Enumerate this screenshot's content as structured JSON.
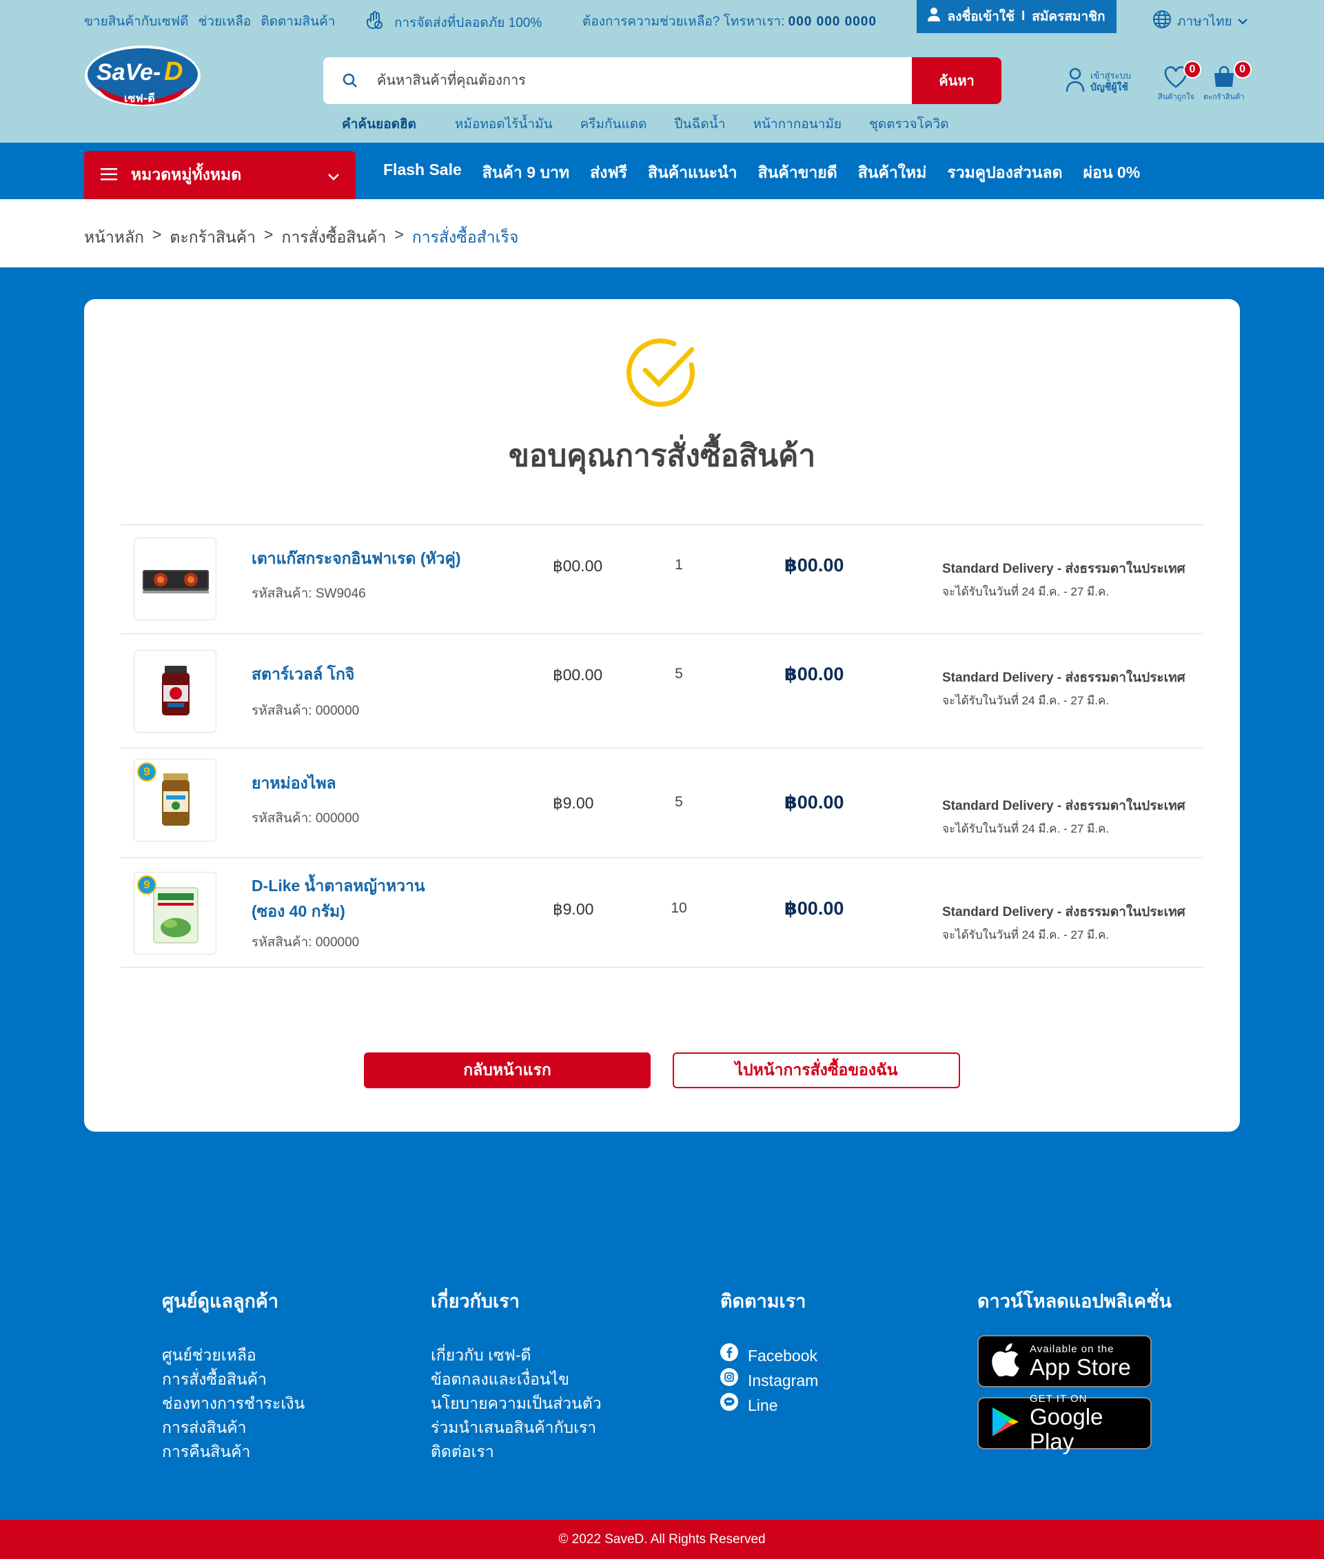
{
  "topbar": {
    "links": [
      "ขายสินค้ากับเซฟดี",
      "ช่วยเหลือ",
      "ติดตามสินค้า"
    ],
    "safe_delivery": "การจัดส่งที่ปลอดภัย 100%",
    "help_text": "ต้องการความช่วยเหลือ? โทรหาเรา:",
    "phone": "000 000 0000",
    "login": "ลงชื่อเข้าใช้",
    "separator": "I",
    "register": "สมัครสมาชิก",
    "language": "ภาษาไทย"
  },
  "logo": {
    "main": "SaVe-D",
    "sub": "เซฟ-ดี"
  },
  "search": {
    "placeholder": "ค้นหาสินค้าที่คุณต้องการ",
    "button": "ค้นหา",
    "hot_title": "คำค้นยอดฮิต",
    "hot_keywords": [
      "หม้อทอดไร้น้ำมัน",
      "ครีมกันแดด",
      "ปืนฉีดน้ำ",
      "หน้ากากอนามัย",
      "ชุดตรวจโควิด"
    ]
  },
  "account": {
    "line1": "เข้าสู่ระบบ",
    "line2": "บัญชีผู้ใช้",
    "wishlist_label": "สินค้าถูกใจ",
    "wishlist_count": "0",
    "cart_label": "ตะกร้าสินค้า",
    "cart_count": "0"
  },
  "nav": {
    "categories": "หมวดหมู่ทั้งหมด",
    "links": [
      "Flash Sale",
      "สินค้า 9 บาท",
      "ส่งฟรี",
      "สินค้าแนะนำ",
      "สินค้าขายดี",
      "สินค้าใหม่",
      "รวมคูปองส่วนลด",
      "ผ่อน 0%"
    ]
  },
  "breadcrumb": {
    "items": [
      "หน้าหลัก",
      "ตะกร้าสินค้า",
      "การสั่งซื้อสินค้า"
    ],
    "sep": ">",
    "active": "การสั่งซื้อสำเร็จ"
  },
  "order": {
    "title": "ขอบคุณการสั่งซื้อสินค้า",
    "items": [
      {
        "name": "เตาแก๊สกระจกอินฟาเรด (หัวคู่)",
        "code": "รหัสสินค้า: SW9046",
        "price": "฿00.00",
        "qty": "1",
        "total": "฿00.00",
        "shipping": "Standard Delivery - ส่งธรรมดาในประเทศ",
        "date": "จะได้รับในวันที่ 24 มี.ค. - 27 มี.ค."
      },
      {
        "name": "สตาร์เวลล์ โกจิ",
        "code": "รหัสสินค้า: 000000",
        "price": "฿00.00",
        "qty": "5",
        "total": "฿00.00",
        "shipping": "Standard Delivery - ส่งธรรมดาในประเทศ",
        "date": "จะได้รับในวันที่ 24 มี.ค. - 27 มี.ค."
      },
      {
        "name": "ยาหม่องไพล",
        "code": "รหัสสินค้า: 000000",
        "price": "฿9.00",
        "qty": "5",
        "total": "฿00.00",
        "shipping": "Standard Delivery - ส่งธรรมดาในประเทศ",
        "date": "จะได้รับในวันที่ 24 มี.ค. - 27 มี.ค.",
        "badge": "9"
      },
      {
        "name": "D-Like น้ำตาลหญ้าหวาน",
        "name2": "(ซอง 40 กรัม)",
        "code": "รหัสสินค้า: 000000",
        "price": "฿9.00",
        "qty": "10",
        "total": "฿00.00",
        "shipping": "Standard Delivery - ส่งธรรมดาในประเทศ",
        "date": "จะได้รับในวันที่ 24 มี.ค. - 27 มี.ค.",
        "badge": "9"
      }
    ],
    "btn_home": "กลับหน้าแรก",
    "btn_orders": "ไปหน้าการสั่งซื้อของฉัน"
  },
  "footer": {
    "customer_title": "ศูนย์ดูแลลูกค้า",
    "customer_links": [
      "ศูนย์ช่วยเหลือ",
      "การสั่งซื้อสินค้า",
      "ช่องทางการชำระเงิน",
      "การส่งสินค้า",
      "การคืนสินค้า"
    ],
    "about_title": "เกี่ยวกับเรา",
    "about_links": [
      "เกี่ยวกับ เซฟ-ดี",
      "ข้อตกลงและเงื่อนไข",
      "นโยบายความเป็นส่วนตัว",
      "ร่วมนำเสนอสินค้ากับเรา",
      "ติดต่อเรา"
    ],
    "follow_title": "ติดตามเรา",
    "social": [
      "Facebook",
      "Instagram",
      "Line"
    ],
    "app_title": "ดาวน์โหลดแอปพลิเคชั่น",
    "appstore_small": "Available on the",
    "appstore_big": "App Store",
    "gplay_small": "GET IT ON",
    "gplay_big": "Google Play",
    "copyright": "© 2022 SaveD. All Rights Reserved"
  },
  "colors": {
    "header_bg": "#a8d4de",
    "primary_blue": "#0072c4",
    "brand_red": "#d0021b",
    "check_yellow": "#f6c200"
  }
}
